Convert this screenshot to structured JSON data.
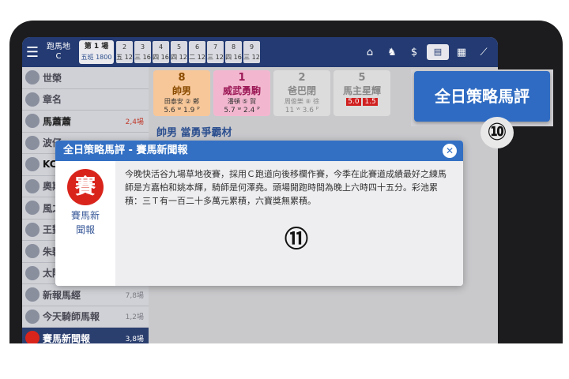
{
  "topbar": {
    "venue_line1": "跑馬地",
    "venue_line2": "C",
    "race_selector_title": "第 1 場",
    "race_selector_sub": "五班 1800",
    "race_buttons": [
      {
        "num": "2",
        "sub": "五 12"
      },
      {
        "num": "3",
        "sub": "三 16"
      },
      {
        "num": "4",
        "sub": "四 16"
      },
      {
        "num": "5",
        "sub": "四 12"
      },
      {
        "num": "6",
        "sub": "二 12"
      },
      {
        "num": "7",
        "sub": "三 12"
      },
      {
        "num": "8",
        "sub": "四 16"
      },
      {
        "num": "9",
        "sub": "三 12"
      }
    ],
    "icons": [
      "home-icon",
      "horse-icon",
      "odds-icon",
      "tips-icon",
      "grid-icon",
      "chart-icon"
    ]
  },
  "sidebar": {
    "items": [
      {
        "label": "世榮",
        "meta": ""
      },
      {
        "label": "章名",
        "meta": ""
      },
      {
        "label": "馬蕭蕭",
        "meta": "2,4場"
      },
      {
        "label": "波仔",
        "meta": ""
      },
      {
        "label": "KC",
        "meta": ""
      },
      {
        "label": "奧斯",
        "meta": ""
      },
      {
        "label": "風之",
        "meta": ""
      },
      {
        "label": "王對",
        "meta": ""
      },
      {
        "label": "朱碧",
        "meta": ""
      },
      {
        "label": "太陽",
        "meta": ""
      },
      {
        "label": "新報馬經",
        "meta": "7,8場"
      },
      {
        "label": "今天騎師馬報",
        "meta": "1,2場"
      },
      {
        "label": "賽馬新聞報",
        "meta": "3,8場"
      }
    ]
  },
  "cards": [
    {
      "num": "8",
      "name": "帥男",
      "sub": "田泰安 ② 鄭",
      "odds": "5.6 ʷ 1.9 ᴾ"
    },
    {
      "num": "1",
      "name": "威武勇駒",
      "sub": "潘頓 ⑤ 賀",
      "odds": "5.7 ʷ 2.4 ᴾ"
    },
    {
      "num": "2",
      "name": "爸巴閉",
      "sub": "周俊樂 ⑧ 徐",
      "odds": "11 ʷ 3.6 ᴾ"
    },
    {
      "num": "5",
      "name": "馬主星輝",
      "sub": "",
      "odds_w": "5.0",
      "odds_p": "1.5"
    }
  ],
  "headline": "帥男 當勇爭霸材",
  "modal": {
    "title": "全日策略馬評 - 賽馬新聞報",
    "close": "✕",
    "logo_glyph": "賽",
    "source_name_1": "賽馬新",
    "source_name_2": "聞報",
    "body": "今晚快活谷九場草地夜賽，採用Ｃ跑道向後移欄作賽，今季在此賽道成績最好之練馬師是方嘉柏和姚本輝，騎師是何澤堯。頭場開跑時間為晚上六時四十五分。彩池累積：三Ｔ有一百二十多萬元累積，六寶獎無累積。"
  },
  "callout": {
    "button_label": "全日策略馬評",
    "marker_10": "⑩",
    "marker_11": "⑪"
  }
}
